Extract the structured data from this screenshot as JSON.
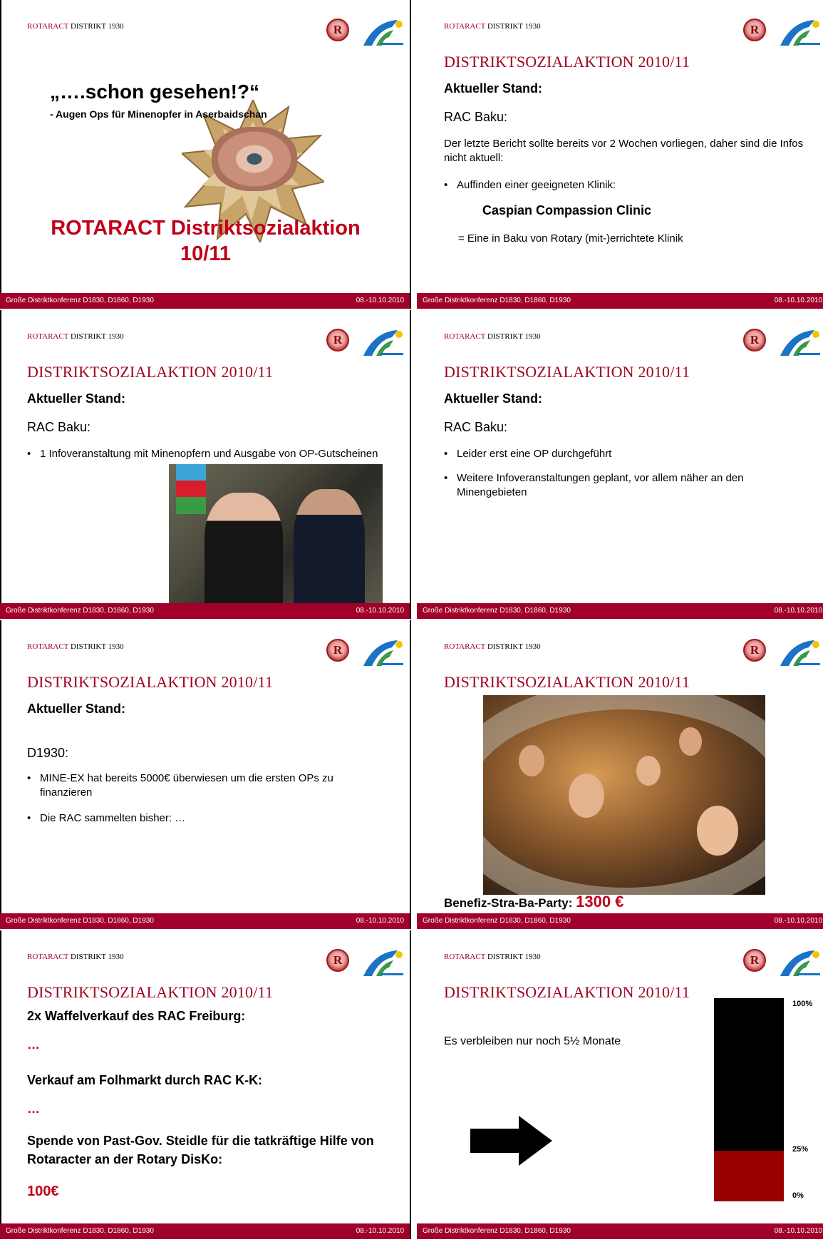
{
  "header": {
    "kicker_red": "ROTARACT",
    "kicker_rest": " DISTRIKT 1930",
    "title": "DISTRIKTSOZIALAKTION 2010/11"
  },
  "footer": {
    "left": "Große Distriktkonferenz D1830, D1860, D1930",
    "right": "08.-10.10.2010"
  },
  "logos": [
    "rotary-logo-icon",
    "district-logo-icon"
  ],
  "colors": {
    "accent": "#a0002a",
    "red_text": "#c0001a",
    "gauge_red": "#990000"
  },
  "slide1": {
    "quote": "„….schon gesehen!?“",
    "subquote": "- Augen Ops für Minenopfer in Aserbaidschan",
    "action_line1": "ROTARACT Distriktsozialaktion",
    "action_line2": "10/11"
  },
  "slide2": {
    "heading": "Aktueller Stand:",
    "club": "RAC Baku:",
    "text": "Der letzte Bericht sollte bereits vor 2 Wochen vorliegen, daher sind die Infos nicht aktuell:",
    "bullet": "Auffinden einer geeigneten Klinik:",
    "clinic": "Caspian Compassion Clinic",
    "clinic_note": "= Eine in Baku von Rotary (mit-)errichtete Klinik"
  },
  "slide3": {
    "heading": "Aktueller Stand:",
    "club": "RAC Baku:",
    "bullet": "1 Infoveranstaltung mit Minenopfern und Ausgabe von OP-Gutscheinen"
  },
  "slide4": {
    "heading": "Aktueller Stand:",
    "club": "RAC Baku:",
    "bullets": [
      "Leider erst eine OP durchgeführt",
      "Weitere Infoveranstaltungen geplant, vor allem näher an den Minengebieten"
    ]
  },
  "slide5": {
    "heading": "Aktueller Stand:",
    "district": "D1930:",
    "bullets": [
      "MINE-EX hat bereits 5000€ überwiesen um die ersten OPs zu finanzieren",
      "Die RAC sammelten bisher: …"
    ]
  },
  "slide6": {
    "label": "Benefiz-Stra-Ba-Party: ",
    "amount": "1300 €"
  },
  "slide7": {
    "item1": "2x Waffelverkauf des RAC Freiburg:",
    "item1_value": "…",
    "item2": "Verkauf am Folhmarkt durch RAC K-K:",
    "item2_value": "…",
    "item3": "Spende von Past-Gov. Steidle für die tatkräftige Hilfe von Rotaracter an der Rotary DisKo:",
    "item3_value": "100€"
  },
  "slide8": {
    "text": "Es verbleiben nur noch 5½ Monate",
    "gauge": {
      "label_top": "100%",
      "label_mid": "25%",
      "label_bottom": "0%",
      "filled_fraction": 0.25
    }
  }
}
